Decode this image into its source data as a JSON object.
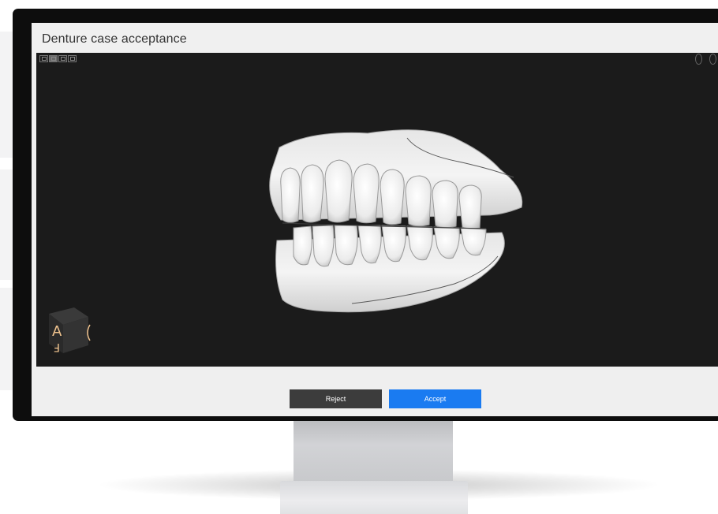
{
  "window": {
    "title": "Denture case acceptance"
  },
  "viewport": {
    "background": "#1b1b1b",
    "view_mode_icons": [
      "view-mode-1-icon",
      "view-mode-2-icon",
      "view-mode-3-icon",
      "view-mode-4-icon"
    ],
    "model": "3d-denture-model",
    "nav_cube_letters": [
      "A",
      "F"
    ]
  },
  "actions": {
    "reject_label": "Reject",
    "accept_label": "Accept",
    "reject_color": "#3c3c3c",
    "accept_color": "#1a7bf1"
  }
}
